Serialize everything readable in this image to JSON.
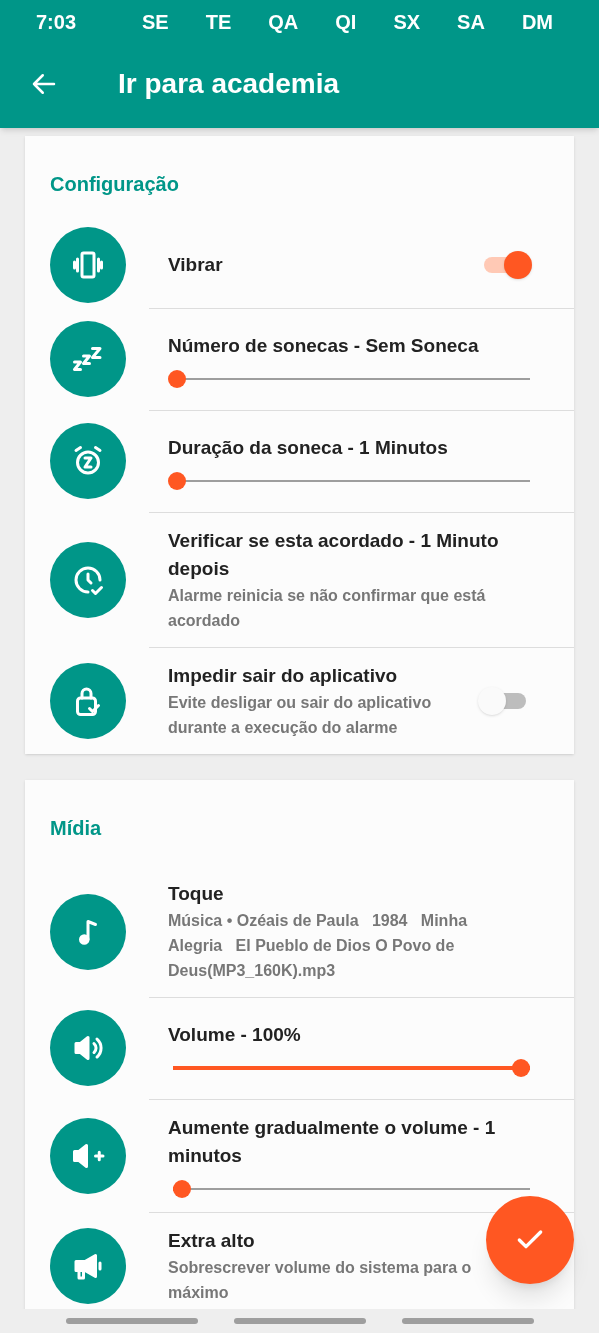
{
  "status_bar": {
    "time": "7:03",
    "days": [
      "SE",
      "TE",
      "QA",
      "QI",
      "SX",
      "SA",
      "DM"
    ]
  },
  "app_bar": {
    "title": "Ir para academia"
  },
  "sections": [
    {
      "title": "Configuração",
      "rows": [
        {
          "kind": "toggle",
          "title": "Vibrar",
          "on": true
        },
        {
          "kind": "slider",
          "title": "Número de sonecas - Sem Soneca",
          "level": 0
        },
        {
          "kind": "slider",
          "title": "Duração da soneca - 1 Minutos",
          "level": 0
        },
        {
          "kind": "text",
          "title": "Verificar se esta acordado - 1 Minuto depois",
          "subtitle": "Alarme reinicia se não confirmar que está acordado"
        },
        {
          "kind": "toggle",
          "title": "Impedir sair do aplicativo",
          "subtitle": "Evite desligar ou sair do aplicativo durante a execução do alarme",
          "on": false
        }
      ]
    },
    {
      "title": "Mídia",
      "rows": [
        {
          "kind": "text",
          "title": "Toque",
          "subtitle": "Música • Ozéais de Paula   1984   Minha Alegria   El Pueblo de Dios O Povo de Deus(MP3_160K).mp3"
        },
        {
          "kind": "slider",
          "title": "Volume - 100%",
          "level": 1
        },
        {
          "kind": "slider",
          "title": "Aumente gradualmente o volume - 1 minutos",
          "level": 0.015
        },
        {
          "kind": "text",
          "title": "Extra alto",
          "subtitle": "Sobrescrever volume do sistema para o máximo"
        }
      ]
    }
  ]
}
